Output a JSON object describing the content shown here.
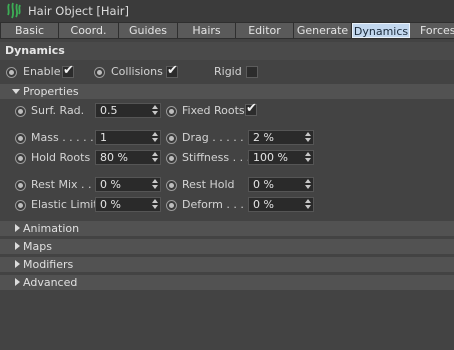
{
  "window": {
    "title": "Hair Object [Hair]",
    "icon": "hair-object-icon",
    "accent": "#2e9e4a"
  },
  "tabs": [
    {
      "label": "Basic",
      "active": false
    },
    {
      "label": "Coord.",
      "active": false
    },
    {
      "label": "Guides",
      "active": false
    },
    {
      "label": "Hairs",
      "active": false
    },
    {
      "label": "Editor",
      "active": false
    },
    {
      "label": "Generate",
      "active": false
    },
    {
      "label": "Dynamics",
      "active": true
    },
    {
      "label": "Forces",
      "active": false
    }
  ],
  "section": {
    "title": "Dynamics"
  },
  "top_options": {
    "enable": {
      "label": "Enable",
      "checked": true
    },
    "collisions": {
      "label": "Collisions",
      "checked": true
    },
    "rigid": {
      "label": "Rigid",
      "checked": false
    }
  },
  "properties": {
    "title": "Properties",
    "surf_rad": {
      "label": "Surf. Rad.",
      "value": "0.5"
    },
    "fixed_roots": {
      "label": "Fixed Roots",
      "checked": true
    },
    "mass": {
      "label": "Mass . . . . . . .",
      "value": "1"
    },
    "drag": {
      "label": "Drag . . . . . .",
      "value": "2 %"
    },
    "hold_roots": {
      "label": "Hold Roots",
      "value": "80 %"
    },
    "stiffness": {
      "label": "Stiffness . . .",
      "value": "100 %"
    },
    "rest_mix": {
      "label": "Rest Mix . . .",
      "value": "0 %"
    },
    "rest_hold": {
      "label": "Rest Hold",
      "value": "0 %"
    },
    "elastic_limit": {
      "label": "Elastic Limit",
      "value": "0 %"
    },
    "deform": {
      "label": "Deform . . . . .",
      "value": "0 %"
    }
  },
  "groups": [
    {
      "label": "Animation"
    },
    {
      "label": "Maps"
    },
    {
      "label": "Modifiers"
    },
    {
      "label": "Advanced"
    }
  ],
  "check_glyph": "✔"
}
